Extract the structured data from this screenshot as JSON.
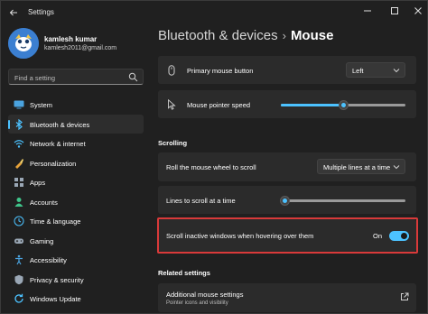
{
  "window": {
    "title": "Settings"
  },
  "profile": {
    "name": "kamlesh kumar",
    "email": "kamlesh2011@gmail.com"
  },
  "search": {
    "placeholder": "Find a setting"
  },
  "sidebar": {
    "items": [
      {
        "label": "System",
        "icon": "monitor-icon",
        "active": false
      },
      {
        "label": "Bluetooth & devices",
        "icon": "bluetooth-icon",
        "active": true
      },
      {
        "label": "Network & internet",
        "icon": "wifi-icon",
        "active": false
      },
      {
        "label": "Personalization",
        "icon": "paintbrush-icon",
        "active": false
      },
      {
        "label": "Apps",
        "icon": "apps-icon",
        "active": false
      },
      {
        "label": "Accounts",
        "icon": "person-icon",
        "active": false
      },
      {
        "label": "Time & language",
        "icon": "globe-clock-icon",
        "active": false
      },
      {
        "label": "Gaming",
        "icon": "gamepad-icon",
        "active": false
      },
      {
        "label": "Accessibility",
        "icon": "accessibility-icon",
        "active": false
      },
      {
        "label": "Privacy & security",
        "icon": "shield-icon",
        "active": false
      },
      {
        "label": "Windows Update",
        "icon": "update-icon",
        "active": false
      }
    ]
  },
  "breadcrumb": {
    "parent": "Bluetooth & devices",
    "separator": "›",
    "current": "Mouse"
  },
  "settings": {
    "primary_button": {
      "label": "Primary mouse button",
      "value": "Left"
    },
    "pointer_speed": {
      "label": "Mouse pointer speed",
      "level": 0.5
    },
    "scrolling_heading": "Scrolling",
    "roll_wheel": {
      "label": "Roll the mouse wheel to scroll",
      "value": "Multiple lines at a time"
    },
    "lines_to_scroll": {
      "label": "Lines to scroll at a time",
      "level": 0.03
    },
    "scroll_inactive": {
      "label": "Scroll inactive windows when hovering over them",
      "state": "On"
    },
    "related_heading": "Related settings",
    "additional_mouse": {
      "title": "Additional mouse settings",
      "subtitle": "Pointer icons and visibility"
    }
  },
  "colors": {
    "accent": "#4cc2ff",
    "highlight_border": "#d93a3a"
  }
}
